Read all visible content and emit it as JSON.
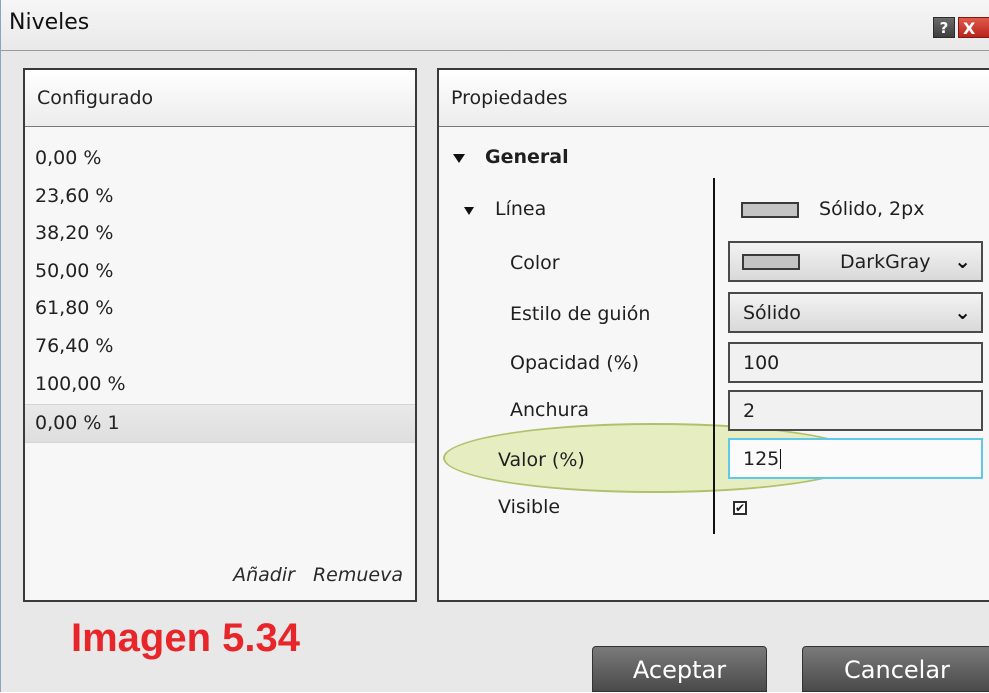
{
  "window": {
    "title": "Niveles",
    "help_label": "?",
    "close_label": "X"
  },
  "left_panel": {
    "header": "Configurado",
    "items": [
      {
        "label": "0,00 %"
      },
      {
        "label": "23,60 %"
      },
      {
        "label": "38,20 %"
      },
      {
        "label": "50,00 %"
      },
      {
        "label": "61,80 %"
      },
      {
        "label": "76,40 %"
      },
      {
        "label": "100,00 %"
      },
      {
        "label": "0,00 % 1",
        "selected": true
      }
    ],
    "add_label": "Añadir",
    "remove_label": "Remueva"
  },
  "right_panel": {
    "header": "Propiedades",
    "general_label": "General",
    "line": {
      "label": "Línea",
      "summary": "Sólido, 2px"
    },
    "color": {
      "label": "Color",
      "value": "DarkGray",
      "swatch": "#c4c4c4"
    },
    "dash_style": {
      "label": "Estilo de guión",
      "value": "Sólido"
    },
    "opacity": {
      "label": "Opacidad (%)",
      "value": "100"
    },
    "width": {
      "label": "Anchura",
      "value": "2"
    },
    "value_pct": {
      "label": "Valor (%)",
      "value": "125"
    },
    "visible": {
      "label": "Visible",
      "checked": true,
      "check_glyph": "✔"
    }
  },
  "caption": "Imagen 5.34",
  "buttons": {
    "accept": "Aceptar",
    "cancel": "Cancelar"
  },
  "colors": {
    "caption_red": "#e8262a",
    "highlight": "#d6e68c",
    "active_border": "#61c8e8"
  }
}
